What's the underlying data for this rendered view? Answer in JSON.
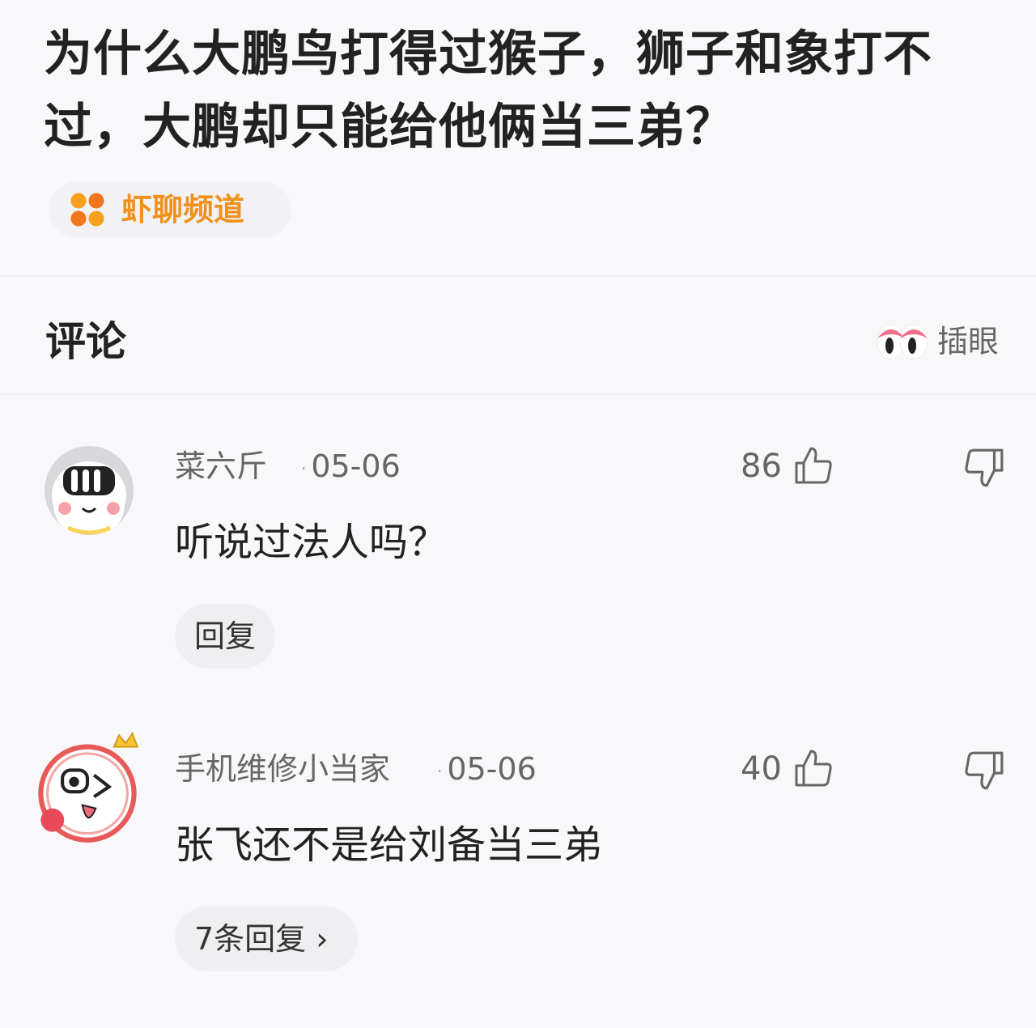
{
  "question": {
    "title": "为什么大鹏鸟打得过猴子，狮子和象打不过，大鹏却只能给他俩当三弟？",
    "channel": "虾聊频道"
  },
  "comments_header": {
    "title": "评论",
    "insert_label": "插眼"
  },
  "comments": [
    {
      "username": "菜六斤",
      "date": "05-06",
      "likes": "86",
      "text": "听说过法人吗？",
      "reply_label": "回复"
    },
    {
      "username": "手机维修小当家",
      "date": "05-06",
      "likes": "40",
      "text": "张飞还不是给刘备当三弟",
      "reply_label": "7条回复 ›"
    }
  ],
  "colors": {
    "accent": "#f0901f",
    "text": "#222222",
    "muted": "#666666",
    "background": "#f8f8fa"
  }
}
